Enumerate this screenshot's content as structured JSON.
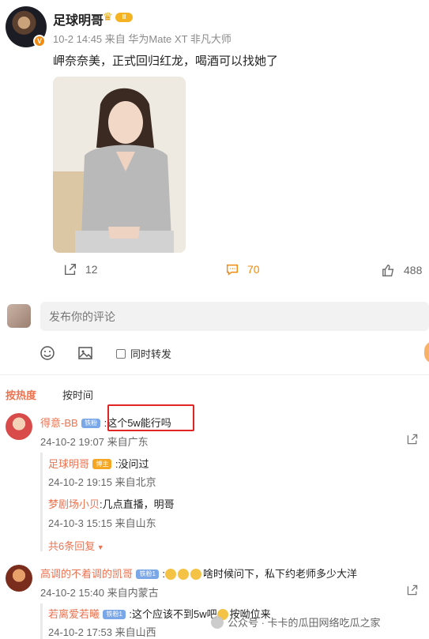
{
  "post": {
    "author": "足球明哥",
    "level_badge": "Ⅲ",
    "verified_badge": "V",
    "meta": "10-2 14:45 来自 华为Mate XT 非凡大师",
    "text": "岬奈奈美，正式回归红龙，喝酒可以找她了",
    "reposts": "12",
    "comments": "70",
    "likes": "488"
  },
  "composer": {
    "placeholder": "发布你的评论",
    "repost_label": "同时转发"
  },
  "tabs": {
    "hot": "按热度",
    "time": "按时间"
  },
  "comments": [
    {
      "user": "得意-BB",
      "fan_badge": "铁粉",
      "text": ":这个5w能行吗",
      "meta": "24-10-2 19:07 来自广东",
      "replies": [
        {
          "user": "足球明哥",
          "badge": "博主",
          "text": ":没问过",
          "meta": "24-10-2 19:15 来自北京"
        },
        {
          "user": "梦剧场小贝",
          "text": ":几点直播，明哥",
          "meta": "24-10-3 15:15 来自山东"
        }
      ],
      "more": "共6条回复"
    },
    {
      "user": "高调的不着调的凯哥",
      "fan_badge": "铁粉1",
      "text": "啥时候问下，私下约老师多少大洋",
      "meta": "24-10-2 15:40 来自内蒙古",
      "replies": [
        {
          "user": "若离爱若曦",
          "badge": "铁粉1",
          "text": ":这个应该不到5w吧",
          "text2": "按呦位来",
          "meta": "24-10-2 17:53 来自山西"
        }
      ]
    }
  ],
  "watermark": "公众号 · 卡卡的瓜田网络吃瓜之家"
}
